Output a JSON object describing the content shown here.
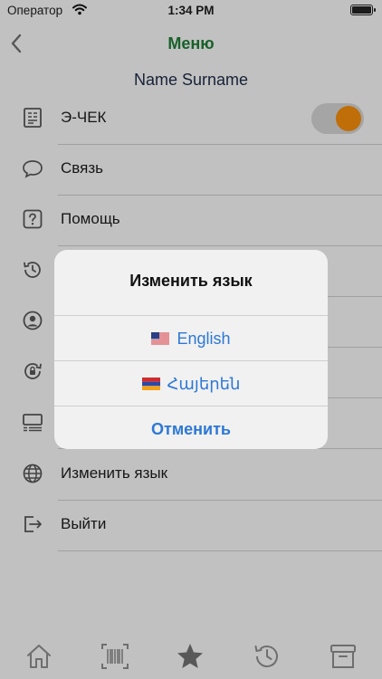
{
  "status_bar": {
    "carrier": "Оператор",
    "time": "1:34 PM"
  },
  "nav": {
    "title": "Меню"
  },
  "user": {
    "name": "Name Surname"
  },
  "menu": [
    {
      "label": "Э-ЧЕК",
      "icon": "receipt-icon",
      "toggle": true
    },
    {
      "label": "Связь",
      "icon": "chat-icon"
    },
    {
      "label": "Помощь",
      "icon": "help-icon"
    },
    {
      "label": "",
      "icon": "history-icon"
    },
    {
      "label": "",
      "icon": "profile-icon"
    },
    {
      "label": "",
      "icon": "lock-rotate-icon"
    },
    {
      "label": "",
      "icon": "list-icon"
    },
    {
      "label": "Изменить язык",
      "icon": "globe-icon"
    },
    {
      "label": "Выйти",
      "icon": "logout-icon"
    }
  ],
  "dialog": {
    "title": "Изменить язык",
    "options": [
      {
        "label": "English",
        "flag": "us-flag-icon"
      },
      {
        "label": "Հայերեն",
        "flag": "armenia-flag-icon"
      }
    ],
    "cancel": "Отменить"
  },
  "tabbar": [
    "home-icon",
    "barcode-icon",
    "star-icon",
    "history-icon",
    "archive-icon"
  ],
  "colors": {
    "accent_green": "#1f7a35",
    "toggle_orange": "#ef8a0a",
    "link_blue": "#2d78d6"
  }
}
